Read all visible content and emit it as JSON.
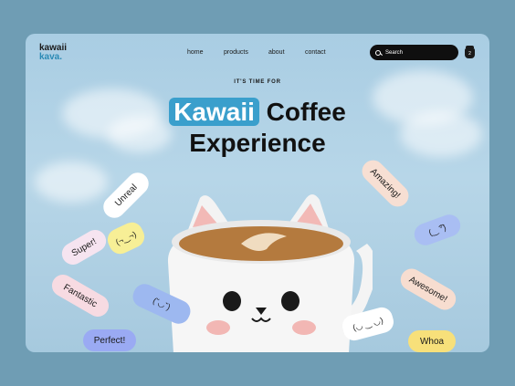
{
  "brand": {
    "line1": "kawaii",
    "line2": "kava."
  },
  "nav": {
    "items": [
      "home",
      "products",
      "about",
      "contact"
    ]
  },
  "search": {
    "placeholder": "Search"
  },
  "cart": {
    "count": "2"
  },
  "hero": {
    "kicker": "IT'S TIME FOR",
    "title_highlight": "Kawaii",
    "title_rest": "Coffee",
    "title_line2": "Experience"
  },
  "stickers": [
    {
      "text": "Unreal"
    },
    {
      "text": "Super!"
    },
    {
      "text": "(¬‿¬)"
    },
    {
      "text": "Fantastic"
    },
    {
      "text": "(˘◡˘)"
    },
    {
      "text": "Perfect!"
    },
    {
      "text": "Amazing!"
    },
    {
      "text": "(‿ ͡°)"
    },
    {
      "text": "Awesome!"
    },
    {
      "text": "(◡ ‿ ◡)"
    },
    {
      "text": "Whoa"
    }
  ],
  "colors": {
    "accent": "#3a9fcc",
    "background": "#6f9db4",
    "sky": "#b7d6e8"
  }
}
